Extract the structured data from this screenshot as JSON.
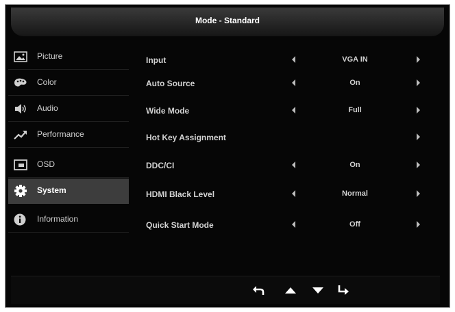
{
  "header": {
    "title": "Mode - Standard"
  },
  "sidebar": {
    "items": [
      {
        "label": "Picture",
        "icon": "picture-icon",
        "selected": false
      },
      {
        "label": "Color",
        "icon": "color-palette-icon",
        "selected": false
      },
      {
        "label": "Audio",
        "icon": "speaker-icon",
        "selected": false
      },
      {
        "label": "Performance",
        "icon": "trend-up-icon",
        "selected": false
      },
      {
        "label": "OSD",
        "icon": "osd-window-icon",
        "selected": false
      },
      {
        "label": "System",
        "icon": "gear-icon",
        "selected": true
      },
      {
        "label": "Information",
        "icon": "info-icon",
        "selected": false
      }
    ]
  },
  "settings": [
    {
      "name": "Input",
      "value": "VGA IN"
    },
    {
      "name": "Auto Source",
      "value": "On"
    },
    {
      "name": "Wide Mode",
      "value": "Full"
    },
    {
      "name": "Hot Key Assignment",
      "value": ""
    },
    {
      "name": "DDC/CI",
      "value": "On"
    },
    {
      "name": "HDMI Black Level",
      "value": "Normal"
    },
    {
      "name": "Quick Start Mode",
      "value": "Off"
    }
  ],
  "footer": {
    "buttons": [
      "return-icon",
      "up-arrow-icon",
      "down-arrow-icon",
      "enter-icon"
    ]
  },
  "colors": {
    "background": "#060606",
    "selected": "#3d3d3d",
    "text": "#d2d2d2"
  }
}
